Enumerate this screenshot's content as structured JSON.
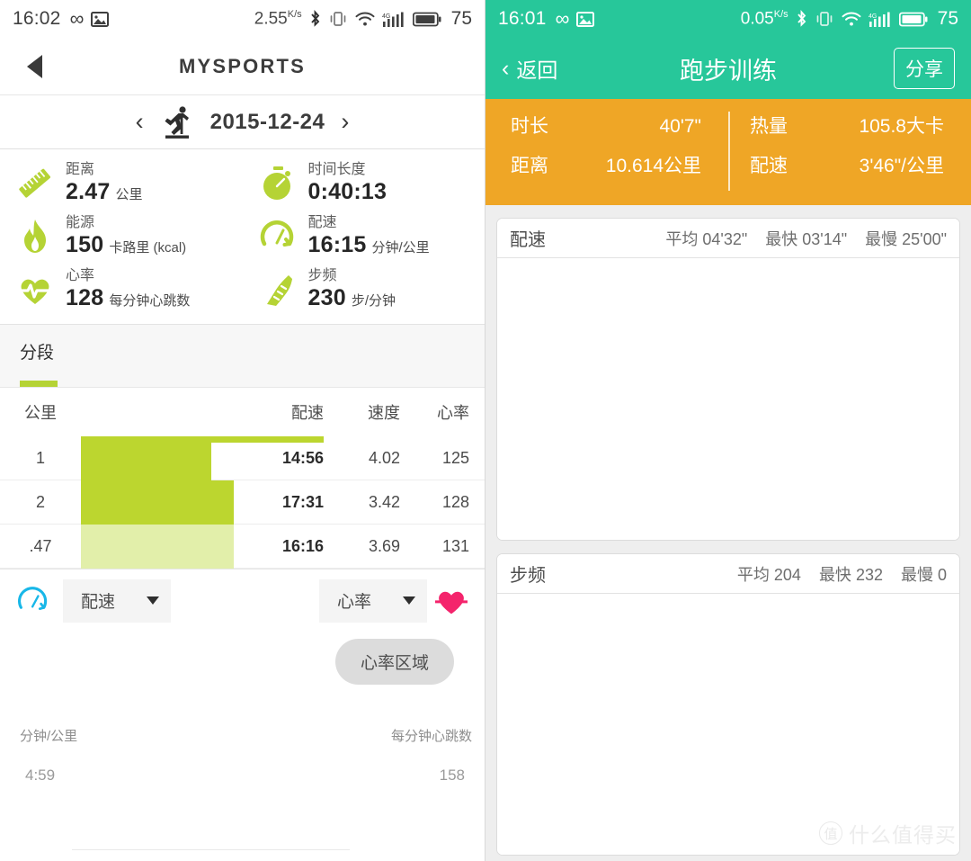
{
  "left": {
    "statusbar": {
      "time": "16:02",
      "infinity_icon": "infinity-icon",
      "image_icon": "image-icon",
      "data_rate": "2.55",
      "data_rate_unit": "K/s",
      "bluetooth_icon": "bluetooth-icon",
      "vibrate_icon": "vibrate-icon",
      "wifi_icon": "wifi-icon",
      "signal_icon": "signal-4g-icon",
      "battery_icon": "battery-icon",
      "battery_level": "75"
    },
    "navbar": {
      "back_icon": "back-arrow-icon",
      "title": "MYSPORTS"
    },
    "date_bar": {
      "prev": "‹",
      "activity_icon": "treadmill-runner-icon",
      "date": "2015-12-24",
      "next": "›"
    },
    "stats": [
      {
        "icon": "ruler-icon",
        "label": "距离",
        "value": "2.47",
        "unit": "公里"
      },
      {
        "icon": "stopwatch-icon",
        "label": "时间长度",
        "value": "0:40:13",
        "unit": ""
      },
      {
        "icon": "flame-icon",
        "label": "能源",
        "value": "150",
        "unit": "卡路里 (kcal)"
      },
      {
        "icon": "gauge-icon",
        "label": "配速",
        "value": "16:15",
        "unit": "分钟/公里"
      },
      {
        "icon": "heart-pulse-icon",
        "label": "心率",
        "value": "128",
        "unit": "每分钟心跳数"
      },
      {
        "icon": "shoe-icon",
        "label": "步频",
        "value": "230",
        "unit": "步/分钟"
      }
    ],
    "section": {
      "title": "分段"
    },
    "table": {
      "columns": [
        "公里",
        "",
        "配速",
        "速度",
        "心率"
      ],
      "rows": [
        {
          "km": "1",
          "pace": "14:56",
          "speed": "4.02",
          "hr": "125",
          "bar_pct": 83,
          "pale": false
        },
        {
          "km": "2",
          "pace": "17:31",
          "speed": "3.42",
          "hr": "128",
          "bar_pct": 97,
          "pale": false
        },
        {
          "km": ".47",
          "pace": "16:16",
          "speed": "3.69",
          "hr": "131",
          "bar_pct": 97,
          "pale": true
        }
      ]
    },
    "controls": {
      "left_icon": "gauge-blue-icon",
      "left_dropdown": "配速",
      "right_dropdown": "心率",
      "right_icon": "heart-pulse-pink-icon",
      "hr_zone_button": "心率区域"
    },
    "chart_axes": {
      "left_label": "分钟/公里",
      "right_label": "每分钟心跳数",
      "left_tick": "4:59",
      "right_tick": "158"
    }
  },
  "right": {
    "statusbar": {
      "time": "16:01",
      "infinity_icon": "infinity-icon",
      "image_icon": "image-icon",
      "data_rate": "0.05",
      "data_rate_unit": "K/s",
      "bluetooth_icon": "bluetooth-icon",
      "vibrate_icon": "vibrate-icon",
      "wifi_icon": "wifi-icon",
      "signal_icon": "signal-4g-icon",
      "battery_icon": "battery-icon",
      "battery_level": "75"
    },
    "navbar": {
      "back_icon": "chevron-left-icon",
      "back_label": "返回",
      "title": "跑步训练",
      "share_label": "分享"
    },
    "summary": [
      {
        "label": "时长",
        "value": "40'7\""
      },
      {
        "label": "热量",
        "value": "105.8大卡"
      },
      {
        "label": "距离",
        "value": "10.614公里"
      },
      {
        "label": "配速",
        "value": "3'46\"/公里"
      }
    ],
    "cards": [
      {
        "title": "配速",
        "stats": [
          "平均 04'32\"",
          "最快 03'14\"",
          "最慢 25'00\""
        ]
      },
      {
        "title": "步频",
        "stats": [
          "平均 204",
          "最快 232",
          "最慢 0"
        ]
      }
    ],
    "watermark": {
      "mark": "值",
      "text": "什么值得买"
    }
  },
  "colors": {
    "green_accent": "#bcd62f",
    "teal_header": "#27c79a",
    "orange_panel": "#efa626",
    "pink": "#f4246c",
    "blue": "#18b7e8"
  },
  "chart_data": {
    "type": "bar",
    "title": "分段",
    "categories": [
      "1",
      "2",
      ".47"
    ],
    "series": [
      {
        "name": "配速",
        "values": [
          "14:56",
          "17:31",
          "16:16"
        ]
      },
      {
        "name": "速度",
        "values": [
          4.02,
          3.42,
          3.69
        ]
      },
      {
        "name": "心率",
        "values": [
          125,
          128,
          131
        ]
      }
    ],
    "bar_lengths_pct": [
      83,
      97,
      97
    ],
    "xlabel": "公里",
    "ylabel": "",
    "legend": false,
    "grid": false
  }
}
